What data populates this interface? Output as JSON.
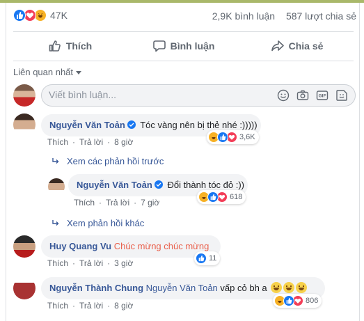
{
  "stats": {
    "reaction_count": "47K",
    "comments": "2,9K bình luận",
    "shares": "587 lượt chia sẻ"
  },
  "actions": {
    "like": "Thích",
    "comment": "Bình luận",
    "share": "Chia sẻ"
  },
  "sort": {
    "label": "Liên quan nhất"
  },
  "composer": {
    "placeholder": "Viết bình luận..."
  },
  "comments": [
    {
      "author": "Nguyễn Văn Toản",
      "verified": true,
      "text": "Tóc vàng nên bị thẻ nhé :)))))",
      "like": "Thích",
      "reply": "Trả lời",
      "time": "8 giờ",
      "reaction_count": "3,6K",
      "replies_link": "Xem các phản hồi trước",
      "reply_item": {
        "author": "Nguyễn Văn Toản",
        "verified": true,
        "text": "Đổi thành tóc đỏ :))",
        "like": "Thích",
        "reply": "Trả lời",
        "time": "7 giờ",
        "reaction_count": "618"
      },
      "more_link": "Xem phản hồi khác"
    },
    {
      "author": "Huy Quang Vu",
      "mention": "Chúc mừng chúc mừng",
      "like": "Thích",
      "reply": "Trả lời",
      "time": "3 giờ",
      "reaction_count": "11"
    },
    {
      "author": "Nguyễn Thành Chung",
      "mention": "Nguyễn Văn Toản",
      "text": "vấp cỏ bh a",
      "like": "Thích",
      "reply": "Trả lời",
      "time": "8 giờ",
      "reaction_count": "806"
    }
  ],
  "colors": {
    "link": "#385898",
    "like": "#1877f2",
    "love": "#f33e58",
    "haha": "#f7b125",
    "bubble": "#f2f3f5"
  }
}
